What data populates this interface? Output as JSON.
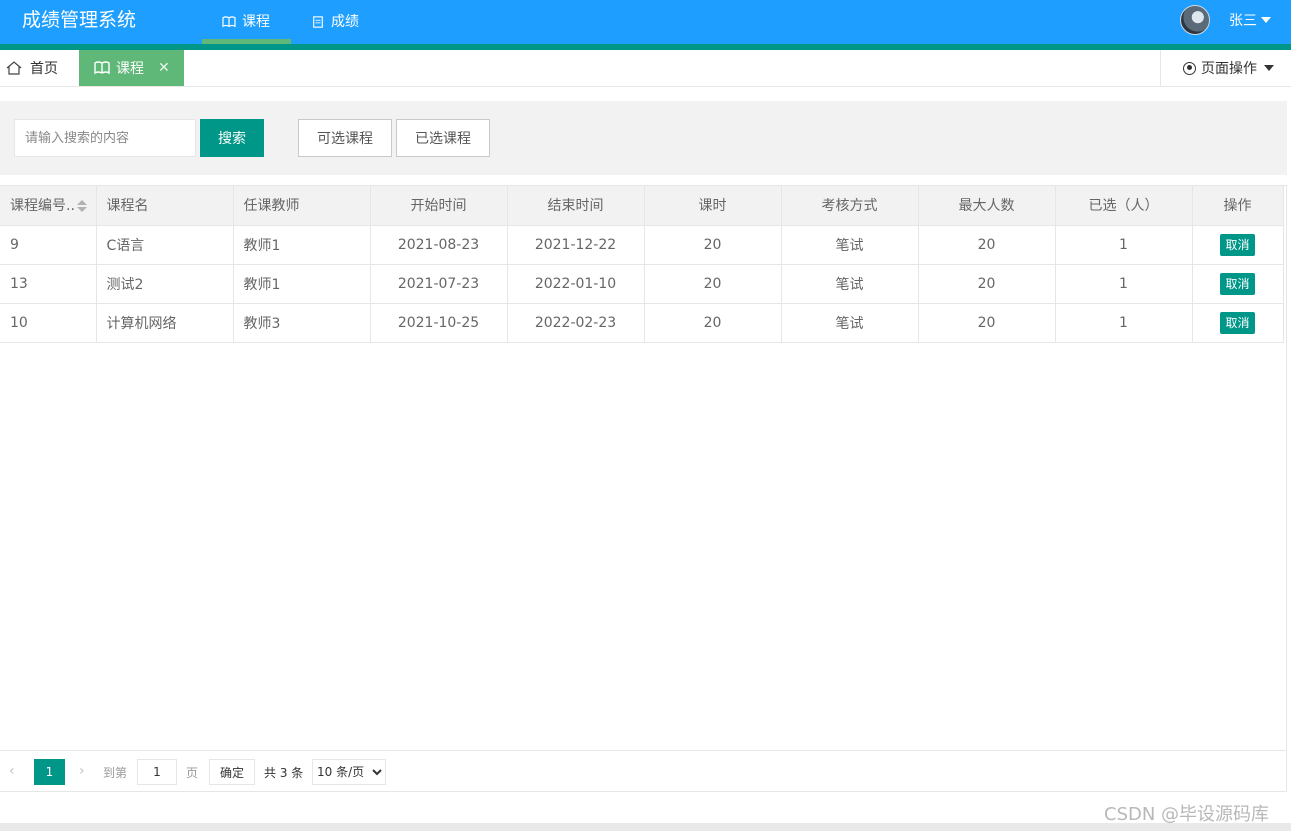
{
  "app": {
    "title": "成绩管理系统"
  },
  "nav": {
    "items": [
      {
        "label": "课程"
      },
      {
        "label": "成绩"
      }
    ]
  },
  "user": {
    "name": "张三"
  },
  "tabs": {
    "home": "首页",
    "course": "课程",
    "page_ops": "页面操作"
  },
  "search": {
    "placeholder": "请输入搜索的内容",
    "button": "搜索"
  },
  "filters": {
    "available": "可选课程",
    "chosen": "已选课程"
  },
  "table": {
    "headers": [
      "课程编号..",
      "课程名",
      "任课教师",
      "开始时间",
      "结束时间",
      "课时",
      "考核方式",
      "最大人数",
      "已选（人）",
      "操作"
    ],
    "rows": [
      {
        "id": "9",
        "name": "C语言",
        "teacher": "教师1",
        "start": "2021-08-23",
        "end": "2021-12-22",
        "hours": "20",
        "exam": "笔试",
        "max": "20",
        "chosen": "1",
        "action": "取消"
      },
      {
        "id": "13",
        "name": "测试2",
        "teacher": "教师1",
        "start": "2021-07-23",
        "end": "2022-01-10",
        "hours": "20",
        "exam": "笔试",
        "max": "20",
        "chosen": "1",
        "action": "取消"
      },
      {
        "id": "10",
        "name": "计算机网络",
        "teacher": "教师3",
        "start": "2021-10-25",
        "end": "2022-02-23",
        "hours": "20",
        "exam": "笔试",
        "max": "20",
        "chosen": "1",
        "action": "取消"
      }
    ]
  },
  "pagination": {
    "current": "1",
    "goto_prefix": "到第",
    "goto_value": "1",
    "page_suffix": "页",
    "confirm": "确定",
    "total": "共 3 条",
    "page_size": "10 条/页"
  },
  "watermark": "CSDN @毕设源码库",
  "colors": {
    "header": "#1e9fff",
    "primary": "#009688",
    "active_tab": "#5fb878"
  }
}
